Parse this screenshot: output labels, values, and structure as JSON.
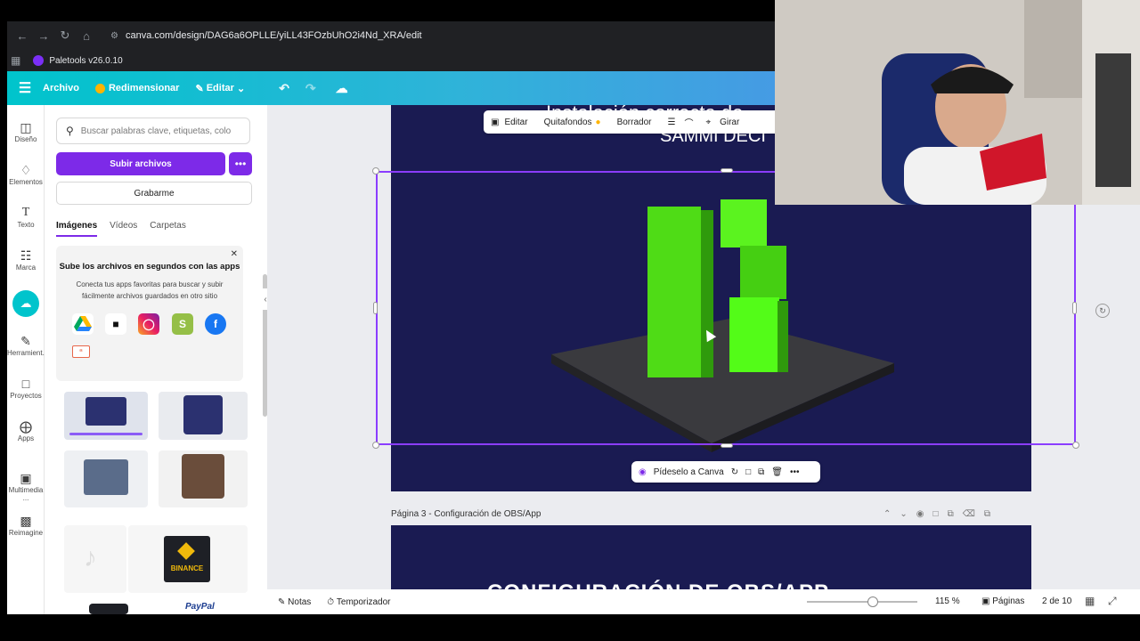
{
  "browser": {
    "url": "canva.com/design/DAG6a6OPLLE/yiLL43FOzbUhO2i4Nd_XRA/edit",
    "bookmark": "Paletools v26.0.10"
  },
  "header": {
    "file_label": "Archivo",
    "resize_label": "Redimensionar",
    "edit_label": "Editar"
  },
  "rail": {
    "items": [
      {
        "label": "Diseño"
      },
      {
        "label": "Elementos"
      },
      {
        "label": "Texto"
      },
      {
        "label": "Marca"
      },
      {
        "label": ""
      },
      {
        "label": "Herramient..."
      },
      {
        "label": "Proyectos"
      },
      {
        "label": "Apps"
      },
      {
        "label": "Multimedia ..."
      },
      {
        "label": "Reimagine"
      }
    ]
  },
  "panel": {
    "search_placeholder": "Buscar palabras clave, etiquetas, colo",
    "upload_label": "Subir archivos",
    "record_label": "Grabarme",
    "tabs": [
      "Imágenes",
      "Vídeos",
      "Carpetas"
    ],
    "promo_title": "Sube los archivos en segundos con las apps",
    "promo_desc": "Conecta tus apps favoritas para buscar y subir fácilmente archivos guardados en otro sitio",
    "binance_label": "BINANCE",
    "paypal_label": "PayPal"
  },
  "canvas": {
    "page2_title_a": "Instalación correcta de",
    "page2_title_b": "SAMMI DECI",
    "toolbar": {
      "edit": "Editar",
      "bg_remover": "Quitafondos",
      "eraser": "Borrador",
      "rotate": "Girar"
    },
    "ask_canva": "Pídeselo a Canva",
    "page3_label": "Página 3 - Configuración de OBS/App",
    "page3_title": "CONFIGURACIÓN DE OBS/APP"
  },
  "footer": {
    "notes": "Notas",
    "timer": "Temporizador",
    "zoom": "115 %",
    "pages": "Páginas",
    "page_count": "2 de 10",
    "zoom_fraction": 0.6
  },
  "colors": {
    "accent": "#7d2ae8",
    "canvas_bg": "#1a1b52",
    "kick_green": "#53fc18"
  }
}
